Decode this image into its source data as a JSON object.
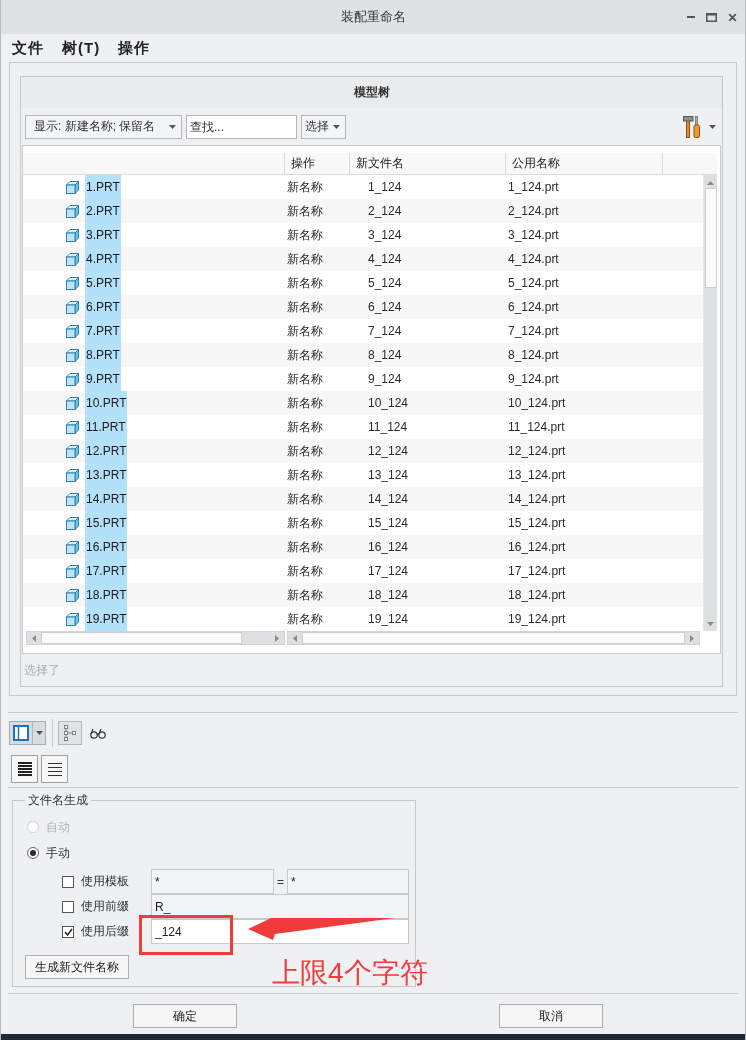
{
  "window": {
    "title": "装配重命名"
  },
  "menu": [
    {
      "label": "文件"
    },
    {
      "label": "树(T)"
    },
    {
      "label": "操作"
    }
  ],
  "model_tree": {
    "title": "模型树",
    "display_filter": "显示: 新建名称; 保留名",
    "search": {
      "placeholder": "查找..."
    },
    "select_button": "选择",
    "columns": [
      "操作",
      "新文件名",
      "公用名称"
    ],
    "rows": [
      {
        "name": "1.PRT",
        "operation": "新名称",
        "new_file_name": "1_124",
        "common_name": "1_124.prt",
        "selected": true
      },
      {
        "name": "2.PRT",
        "operation": "新名称",
        "new_file_name": "2_124",
        "common_name": "2_124.prt",
        "selected": true
      },
      {
        "name": "3.PRT",
        "operation": "新名称",
        "new_file_name": "3_124",
        "common_name": "3_124.prt",
        "selected": true
      },
      {
        "name": "4.PRT",
        "operation": "新名称",
        "new_file_name": "4_124",
        "common_name": "4_124.prt",
        "selected": true
      },
      {
        "name": "5.PRT",
        "operation": "新名称",
        "new_file_name": "5_124",
        "common_name": "5_124.prt",
        "selected": true
      },
      {
        "name": "6.PRT",
        "operation": "新名称",
        "new_file_name": "6_124",
        "common_name": "6_124.prt",
        "selected": true
      },
      {
        "name": "7.PRT",
        "operation": "新名称",
        "new_file_name": "7_124",
        "common_name": "7_124.prt",
        "selected": true
      },
      {
        "name": "8.PRT",
        "operation": "新名称",
        "new_file_name": "8_124",
        "common_name": "8_124.prt",
        "selected": true
      },
      {
        "name": "9.PRT",
        "operation": "新名称",
        "new_file_name": "9_124",
        "common_name": "9_124.prt",
        "selected": true
      },
      {
        "name": "10.PRT",
        "operation": "新名称",
        "new_file_name": "10_124",
        "common_name": "10_124.prt",
        "selected": true
      },
      {
        "name": "11.PRT",
        "operation": "新名称",
        "new_file_name": "11_124",
        "common_name": "11_124.prt",
        "selected": true
      },
      {
        "name": "12.PRT",
        "operation": "新名称",
        "new_file_name": "12_124",
        "common_name": "12_124.prt",
        "selected": true
      },
      {
        "name": "13.PRT",
        "operation": "新名称",
        "new_file_name": "13_124",
        "common_name": "13_124.prt",
        "selected": true
      },
      {
        "name": "14.PRT",
        "operation": "新名称",
        "new_file_name": "14_124",
        "common_name": "14_124.prt",
        "selected": true
      },
      {
        "name": "15.PRT",
        "operation": "新名称",
        "new_file_name": "15_124",
        "common_name": "15_124.prt",
        "selected": true
      },
      {
        "name": "16.PRT",
        "operation": "新名称",
        "new_file_name": "16_124",
        "common_name": "16_124.prt",
        "selected": true
      },
      {
        "name": "17.PRT",
        "operation": "新名称",
        "new_file_name": "17_124",
        "common_name": "17_124.prt",
        "selected": true
      },
      {
        "name": "18.PRT",
        "operation": "新名称",
        "new_file_name": "18_124",
        "common_name": "18_124.prt",
        "selected": true
      },
      {
        "name": "19.PRT",
        "operation": "新名称",
        "new_file_name": "19_124",
        "common_name": "19_124.prt",
        "selected": true
      }
    ],
    "status_text": "选择了"
  },
  "file_name_generation": {
    "title": "文件名生成",
    "modes": [
      {
        "label": "自动",
        "selected": false,
        "disabled": true
      },
      {
        "label": "手动",
        "selected": true,
        "disabled": false
      }
    ],
    "options": [
      {
        "kind": "template",
        "label": "使用模板",
        "checked": false,
        "value": "*",
        "separator": "=",
        "value_2": "*"
      },
      {
        "kind": "affix",
        "label": "使用前缀",
        "checked": false,
        "value": "R_"
      },
      {
        "kind": "affix",
        "label": "使用后缀",
        "checked": true,
        "value": "_124"
      }
    ],
    "generate_button": "生成新文件名称"
  },
  "buttons": [
    "确定",
    "取消"
  ],
  "annotation": {
    "text": "上限4个字符"
  }
}
